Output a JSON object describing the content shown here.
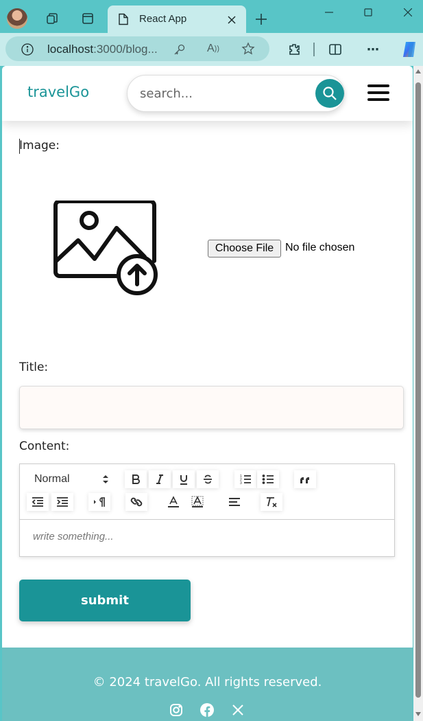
{
  "browser": {
    "tab_title": "React App",
    "url_host": "localhost",
    "url_rest": ":3000/blog..."
  },
  "site": {
    "brand": "travelGo",
    "search_placeholder": "search..."
  },
  "form": {
    "image_label": "Image:",
    "choose_file_label": "Choose File",
    "file_status": "No file chosen",
    "title_label": "Title:",
    "title_value": "",
    "content_label": "Content:",
    "header_select": "Normal",
    "editor_placeholder": "write something...",
    "submit_label": "submit"
  },
  "footer": {
    "copyright": "© 2024 travelGo. All rights reserved.",
    "social_icons": [
      "instagram-icon",
      "facebook-icon",
      "x-icon"
    ]
  },
  "colors": {
    "brand": "#1a9497",
    "chrome": "#58c5c7",
    "footer": "#6cc0c1"
  }
}
